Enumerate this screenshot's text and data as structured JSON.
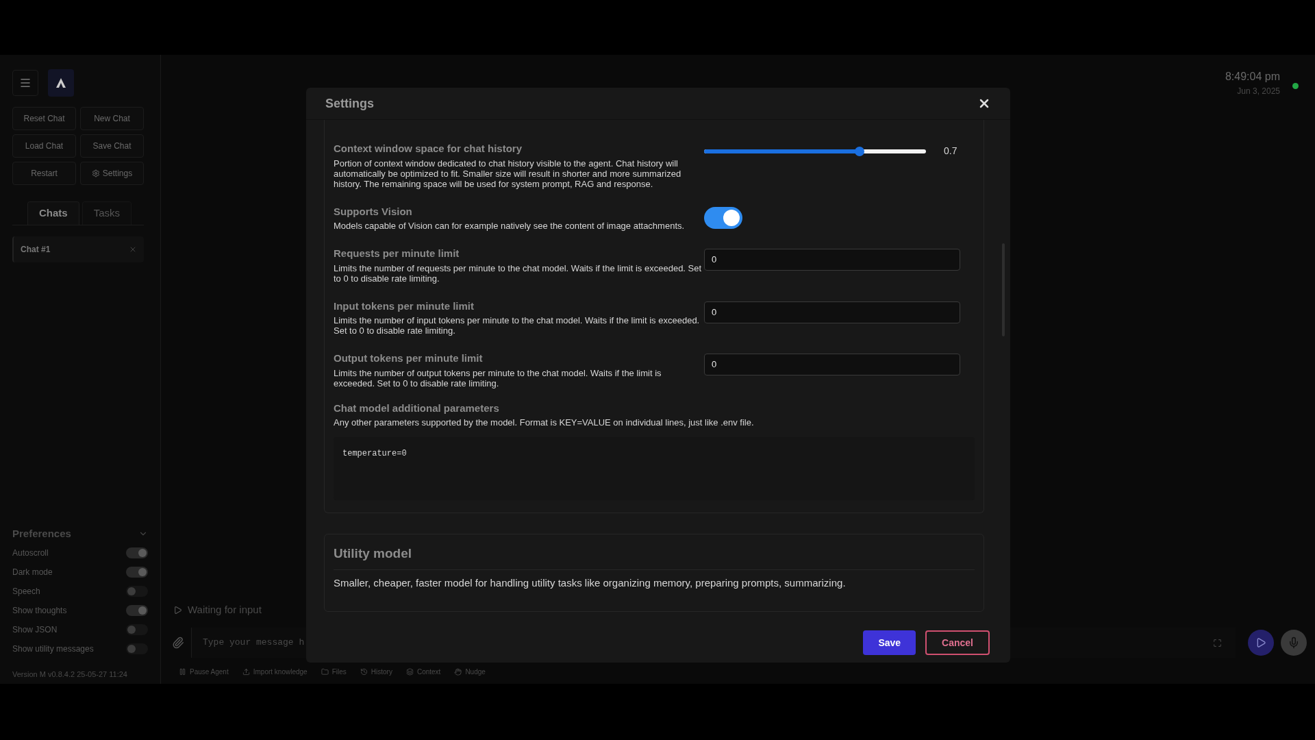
{
  "sidebar": {
    "buttons": [
      {
        "label": "Reset Chat",
        "kind": "plain"
      },
      {
        "label": "New Chat",
        "kind": "plain"
      },
      {
        "label": "Load Chat",
        "kind": "plain"
      },
      {
        "label": "Save Chat",
        "kind": "plain"
      },
      {
        "label": "Restart",
        "kind": "plain"
      },
      {
        "label": "Settings",
        "kind": "settings"
      }
    ],
    "tabs": [
      {
        "label": "Chats",
        "selected": true
      },
      {
        "label": "Tasks",
        "selected": false
      }
    ],
    "chats": [
      {
        "title": "Chat #1",
        "selected": true
      }
    ],
    "preferences": {
      "title": "Preferences",
      "expanded": true,
      "items": [
        {
          "label": "Autoscroll",
          "on": true
        },
        {
          "label": "Dark mode",
          "on": true
        },
        {
          "label": "Speech",
          "on": false
        },
        {
          "label": "Show thoughts",
          "on": true
        },
        {
          "label": "Show JSON",
          "on": false
        },
        {
          "label": "Show utility messages",
          "on": false
        }
      ]
    },
    "version": "Version M v0.8.4.2 25-05-27 11:24"
  },
  "main": {
    "status": "Waiting for input",
    "message_placeholder": "Type your message h",
    "toolbar": [
      {
        "label": "Pause Agent",
        "kind": "pause"
      },
      {
        "label": "Import knowledge",
        "kind": "upload"
      },
      {
        "label": "Files",
        "kind": "folder"
      },
      {
        "label": "History",
        "kind": "history"
      },
      {
        "label": "Context",
        "kind": "layers"
      },
      {
        "label": "Nudge",
        "kind": "hand"
      }
    ],
    "clock": {
      "time": "8:49:04 pm",
      "date": "Jun 3, 2025",
      "connected": true
    }
  },
  "settings": {
    "title": "Settings",
    "fields": [
      {
        "kind": "slider",
        "label": "Context window space for chat history",
        "description": "Portion of context window dedicated to chat history visible to the agent. Chat history will automatically be optimized to fit. Smaller size will result in shorter and more summarized history. The remaining space will be used for system prompt, RAG and response.",
        "level": 0.7,
        "reading": "0.7"
      },
      {
        "kind": "switch",
        "label": "Supports Vision",
        "description": "Models capable of Vision can for example natively see the content of image attachments.",
        "on": true
      },
      {
        "kind": "number",
        "label": "Requests per minute limit",
        "description": "Limits the number of requests per minute to the chat model. Waits if the limit is exceeded. Set to 0 to disable rate limiting.",
        "value": "0"
      },
      {
        "kind": "number",
        "label": "Input tokens per minute limit",
        "description": "Limits the number of input tokens per minute to the chat model. Waits if the limit is exceeded. Set to 0 to disable rate limiting.",
        "value": "0"
      },
      {
        "kind": "number",
        "label": "Output tokens per minute limit",
        "description": "Limits the number of output tokens per minute to the chat model. Waits if the limit is exceeded. Set to 0 to disable rate limiting.",
        "value": "0"
      },
      {
        "kind": "textarea",
        "label": "Chat model additional parameters",
        "description": "Any other parameters supported by the model. Format is KEY=VALUE on individual lines, just like .env file.",
        "value": "temperature=0"
      }
    ],
    "next_section": {
      "title": "Utility model",
      "description": "Smaller, cheaper, faster model for handling utility tasks like organizing memory, preparing prompts, summarizing."
    },
    "buttons": [
      {
        "label": "Save",
        "kind": "primary"
      },
      {
        "label": "Cancel",
        "kind": "secondary"
      }
    ]
  }
}
